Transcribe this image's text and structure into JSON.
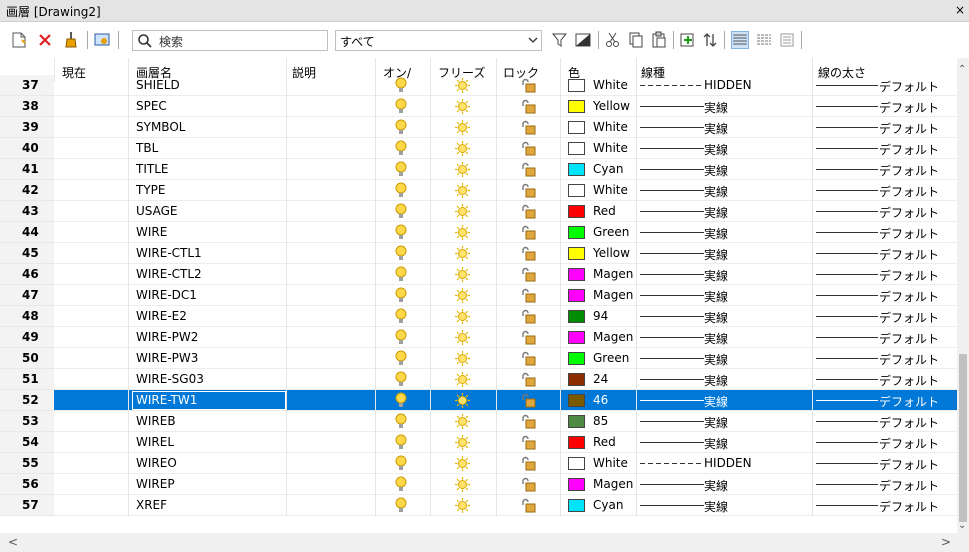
{
  "window": {
    "title": "画層 [Drawing2]",
    "close": "×"
  },
  "search": {
    "placeholder": "検索"
  },
  "filter": {
    "value": "すべて"
  },
  "columns": [
    "現在",
    "画層名",
    "説明",
    "オン/",
    "フリーズ",
    "ロック",
    "色",
    "線種",
    "線の太さ"
  ],
  "rows": [
    {
      "num": "37",
      "name": "SHIELD",
      "color": "White",
      "hex": "#ffffff",
      "linetype": "HIDDEN",
      "lineweight": "デフォルト"
    },
    {
      "num": "38",
      "name": "SPEC",
      "color": "Yellow",
      "hex": "#ffff00",
      "linetype": "実線",
      "lineweight": "デフォルト"
    },
    {
      "num": "39",
      "name": "SYMBOL",
      "color": "White",
      "hex": "#ffffff",
      "linetype": "実線",
      "lineweight": "デフォルト"
    },
    {
      "num": "40",
      "name": "TBL",
      "color": "White",
      "hex": "#ffffff",
      "linetype": "実線",
      "lineweight": "デフォルト"
    },
    {
      "num": "41",
      "name": "TITLE",
      "color": "Cyan",
      "hex": "#00e5ff",
      "linetype": "実線",
      "lineweight": "デフォルト"
    },
    {
      "num": "42",
      "name": "TYPE",
      "color": "White",
      "hex": "#ffffff",
      "linetype": "実線",
      "lineweight": "デフォルト"
    },
    {
      "num": "43",
      "name": "USAGE",
      "color": "Red",
      "hex": "#ff0000",
      "linetype": "実線",
      "lineweight": "デフォルト"
    },
    {
      "num": "44",
      "name": "WIRE",
      "color": "Green",
      "hex": "#00ff00",
      "linetype": "実線",
      "lineweight": "デフォルト"
    },
    {
      "num": "45",
      "name": "WIRE-CTL1",
      "color": "Yellow",
      "hex": "#ffff00",
      "linetype": "実線",
      "lineweight": "デフォルト"
    },
    {
      "num": "46",
      "name": "WIRE-CTL2",
      "color": "Magen",
      "hex": "#ff00ff",
      "linetype": "実線",
      "lineweight": "デフォルト"
    },
    {
      "num": "47",
      "name": "WIRE-DC1",
      "color": "Magen",
      "hex": "#ff00ff",
      "linetype": "実線",
      "lineweight": "デフォルト"
    },
    {
      "num": "48",
      "name": "WIRE-E2",
      "color": "94",
      "hex": "#008c00",
      "linetype": "実線",
      "lineweight": "デフォルト"
    },
    {
      "num": "49",
      "name": "WIRE-PW2",
      "color": "Magen",
      "hex": "#ff00ff",
      "linetype": "実線",
      "lineweight": "デフォルト"
    },
    {
      "num": "50",
      "name": "WIRE-PW3",
      "color": "Green",
      "hex": "#00ff00",
      "linetype": "実線",
      "lineweight": "デフォルト"
    },
    {
      "num": "51",
      "name": "WIRE-SG03",
      "color": "24",
      "hex": "#8c2d00",
      "linetype": "実線",
      "lineweight": "デフォルト"
    },
    {
      "num": "52",
      "name": "WIRE-TW1",
      "color": "46",
      "hex": "#7a5a00",
      "linetype": "実線",
      "lineweight": "デフォルト"
    },
    {
      "num": "53",
      "name": "WIREB",
      "color": "85",
      "hex": "#4f8a44",
      "linetype": "実線",
      "lineweight": "デフォルト"
    },
    {
      "num": "54",
      "name": "WIREL",
      "color": "Red",
      "hex": "#ff0000",
      "linetype": "実線",
      "lineweight": "デフォルト"
    },
    {
      "num": "55",
      "name": "WIREO",
      "color": "White",
      "hex": "#ffffff",
      "linetype": "HIDDEN",
      "lineweight": "デフォルト"
    },
    {
      "num": "56",
      "name": "WIREP",
      "color": "Magen",
      "hex": "#ff00ff",
      "linetype": "実線",
      "lineweight": "デフォルト"
    },
    {
      "num": "57",
      "name": "XREF",
      "color": "Cyan",
      "hex": "#00e5ff",
      "linetype": "実線",
      "lineweight": "デフォルト"
    }
  ],
  "selected_row": "52",
  "colors": {
    "selection": "#0078d7",
    "bulb": "#ffd84a",
    "sun": "#ffe36a"
  }
}
